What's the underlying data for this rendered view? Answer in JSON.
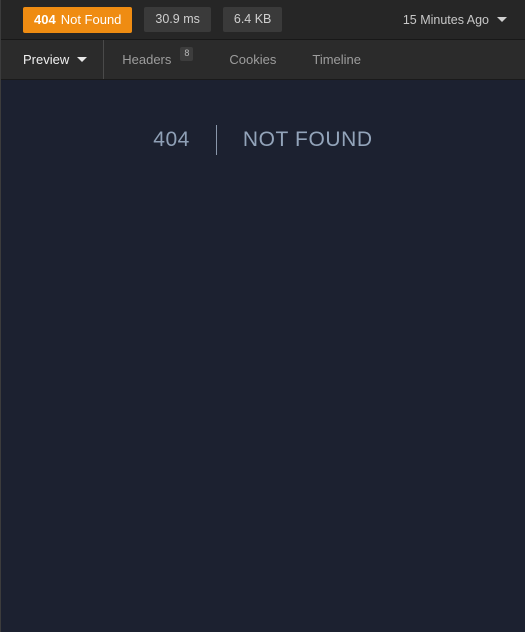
{
  "statusbar": {
    "status_code": "404",
    "status_text": "Not Found",
    "status_color": "#ef8c12",
    "timing": "30.9 ms",
    "size": "6.4 KB",
    "timestamp": "15 Minutes Ago",
    "timestamp_caret_icon": "chevron-down-icon"
  },
  "tabs": [
    {
      "label": "Preview",
      "active": true,
      "badge": null,
      "caret_icon": "chevron-down-icon"
    },
    {
      "label": "Headers",
      "active": false,
      "badge": "8",
      "caret_icon": null
    },
    {
      "label": "Cookies",
      "active": false,
      "badge": null,
      "caret_icon": null
    },
    {
      "label": "Timeline",
      "active": false,
      "badge": null,
      "caret_icon": null
    }
  ],
  "preview": {
    "error_code": "404",
    "error_message": "NOT FOUND",
    "background_color": "#1c2130",
    "text_color": "#8fa0b6"
  }
}
